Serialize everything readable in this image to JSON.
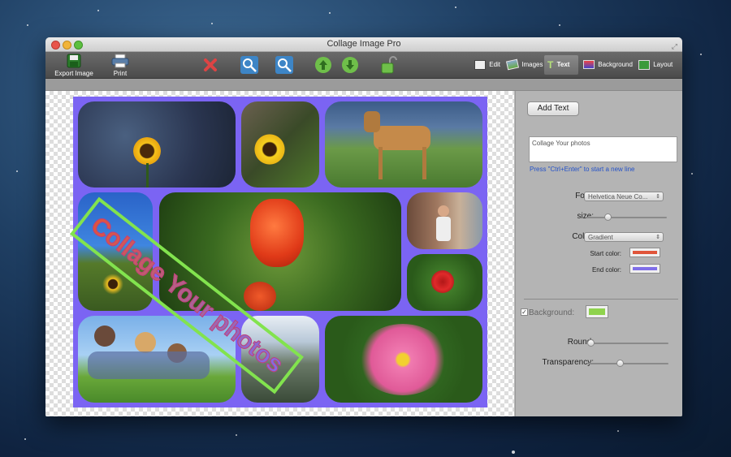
{
  "window": {
    "title": "Collage Image Pro"
  },
  "toolbar": {
    "export_label": "Export Image",
    "print_label": "Print",
    "tabs": [
      {
        "label": "Edit",
        "icon": "edit-icon"
      },
      {
        "label": "Images",
        "icon": "images-icon"
      },
      {
        "label": "Text",
        "icon": "text-icon"
      },
      {
        "label": "Background",
        "icon": "background-icon"
      },
      {
        "label": "Layout",
        "icon": "layout-icon"
      }
    ],
    "active_tab": "Text"
  },
  "canvas": {
    "overlay_text": "Collage Your photos",
    "background_color": "#7b64f3",
    "photos": [
      "sunflower-sky",
      "sunflower-leaves",
      "great-dane",
      "sunflowers-field",
      "red-tulip",
      "girl-street",
      "red-rose",
      "family-grass",
      "forest-stream",
      "pink-flower"
    ]
  },
  "panel": {
    "add_text_label": "Add Text",
    "text_value": "Collage Your photos",
    "hint": "Press \"Ctrl+Enter\" to start a new line",
    "font_label": "Font:",
    "font_value": "Helvetica Neue Co...",
    "size_label": "size:",
    "size_level": 0.25,
    "color_label": "Color:",
    "color_value": "Gradient",
    "start_color_label": "Start color:",
    "start_color": "#e0553a",
    "end_color_label": "End color:",
    "end_color": "#7f6ee8",
    "background_label": "Background:",
    "background_checked": true,
    "background_color": "#8fd34d",
    "round_label": "Round:",
    "round_level": 0.0,
    "transparency_label": "Transparency:",
    "transparency_level": 0.4
  }
}
